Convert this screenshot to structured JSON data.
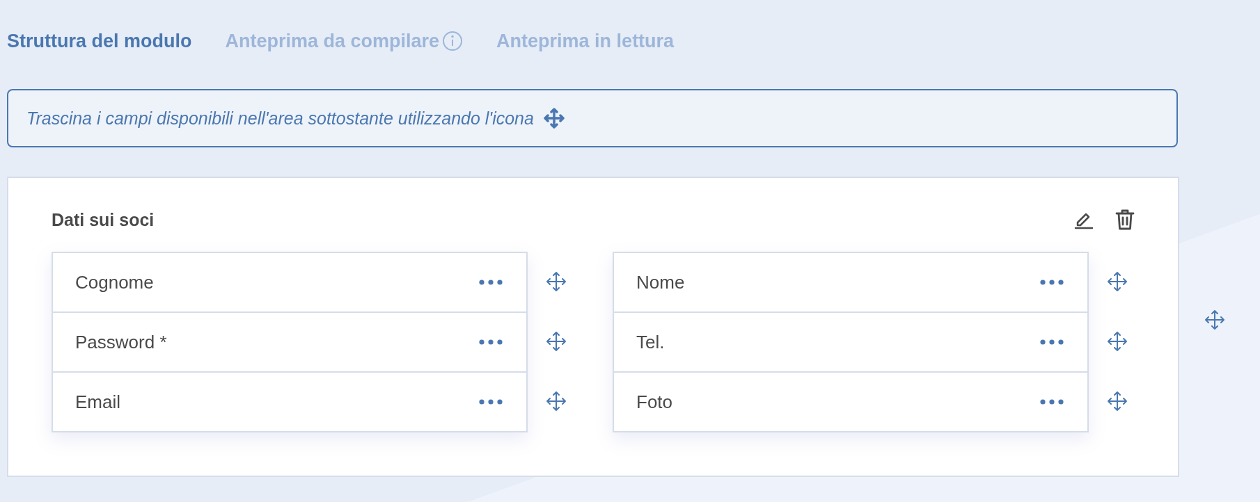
{
  "tabs": [
    {
      "label": "Struttura del modulo",
      "selected": true,
      "info": false
    },
    {
      "label": "Anteprima da compilare",
      "selected": false,
      "info": true
    },
    {
      "label": "Anteprima in lettura",
      "selected": false,
      "info": false
    }
  ],
  "hint": "Trascina i campi disponibili nell'area sottostante utilizzando l'icona",
  "section": {
    "title": "Dati sui soci",
    "columns": [
      [
        {
          "label": "Cognome"
        },
        {
          "label": "Password *"
        },
        {
          "label": "Email"
        }
      ],
      [
        {
          "label": "Nome"
        },
        {
          "label": "Tel."
        },
        {
          "label": "Foto"
        }
      ]
    ]
  }
}
